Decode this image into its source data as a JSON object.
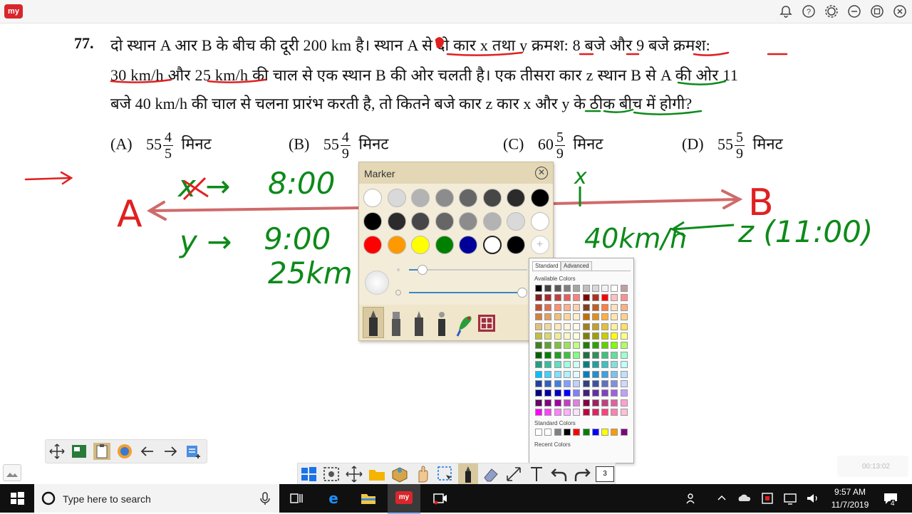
{
  "app": {
    "logo_text": "my"
  },
  "topbar_icons": [
    "bell-icon",
    "help-icon",
    "gear-icon",
    "minimize-icon",
    "restore-icon",
    "close-icon"
  ],
  "question": {
    "number": "77.",
    "line1": "दो स्थान A आर B के बीच की दूरी 200 km है। स्थान A से दो कार x तथा y क्रमश: 8 बजे और 9 बजे क्रमश:",
    "line2": "30 km/h और 25 km/h की चाल से एक स्थान B की ओर चलती है। एक तीसरा कार z स्थान B से A की ओर 11",
    "line3": "बजे  40 km/h की चाल से चलना प्रारंभ करती है, तो कितने बजे कार z कार x और y के ठीक बीच में होगी?",
    "options": [
      {
        "label": "(A)",
        "whole": "55",
        "num": "4",
        "den": "5",
        "unit": "मिनट"
      },
      {
        "label": "(B)",
        "whole": "55",
        "num": "4",
        "den": "9",
        "unit": "मिनट"
      },
      {
        "label": "(C)",
        "whole": "60",
        "num": "5",
        "den": "9",
        "unit": "मिनट"
      },
      {
        "label": "(D)",
        "whole": "55",
        "num": "5",
        "den": "9",
        "unit": "मिनट"
      }
    ]
  },
  "handwriting": {
    "x_arrow": "x →",
    "x_time": "8:00",
    "y_arrow": "y →",
    "y_time": "9:00",
    "y_speed": "25km",
    "point_a": "A",
    "point_b": "B",
    "x_mark": "x",
    "z_speed": "40km/h",
    "z_time": "z (11:00)",
    "colors": {
      "red": "#e02020",
      "green": "#0d8a1a",
      "line": "#d06a6a"
    }
  },
  "marker_panel": {
    "title": "Marker",
    "swatch_rows": [
      [
        "#ffffff",
        "#d9d9d9",
        "#b3b3b3",
        "#8c8c8c",
        "#666666",
        "#474747",
        "#2b2b2b",
        "#000000"
      ],
      [
        "#000000",
        "#2b2b2b",
        "#474747",
        "#666666",
        "#8c8c8c",
        "#b3b3b3",
        "#d9d9d9",
        "#ffffff"
      ],
      [
        "#ff0000",
        "#ff9900",
        "#ffff00",
        "#008000",
        "#000099",
        "#ffffff",
        "#000000",
        "add"
      ]
    ],
    "selected_swatch": "#ffffff",
    "tools": [
      "marker-tool-1",
      "marker-tool-2",
      "marker-tool-3",
      "marker-tool-4",
      "parrot-icon",
      "pattern-icon"
    ]
  },
  "color_picker": {
    "tabs": [
      "Standard",
      "Advanced"
    ],
    "available_label": "Available Colors",
    "standard_label": "Standard Colors",
    "recent_label": "Recent Colors",
    "standard_colors": [
      "#ffffff",
      "#ffffff",
      "#808080",
      "#000000",
      "#ff0000",
      "#008000",
      "#0000ff",
      "#ffff00",
      "#ff9900",
      "#800080"
    ]
  },
  "left_toolbar": [
    "move-icon",
    "whiteboard-icon",
    "clipboard-icon",
    "browser-icon",
    "back-arrow-icon",
    "forward-arrow-icon",
    "add-page-icon"
  ],
  "main_toolbar": [
    "windows-icon",
    "screenshot-icon",
    "move-icon",
    "folder-icon",
    "package-icon",
    "hand-icon",
    "select-icon",
    "marker-icon",
    "eraser-icon",
    "resize-icon",
    "text-icon",
    "undo-icon",
    "redo-icon"
  ],
  "page_number": "3",
  "recorder_time": "00:13:02",
  "taskbar": {
    "search_placeholder": "Type here to search",
    "time": "9:57 AM",
    "date": "11/7/2019",
    "notification_count": "4"
  }
}
